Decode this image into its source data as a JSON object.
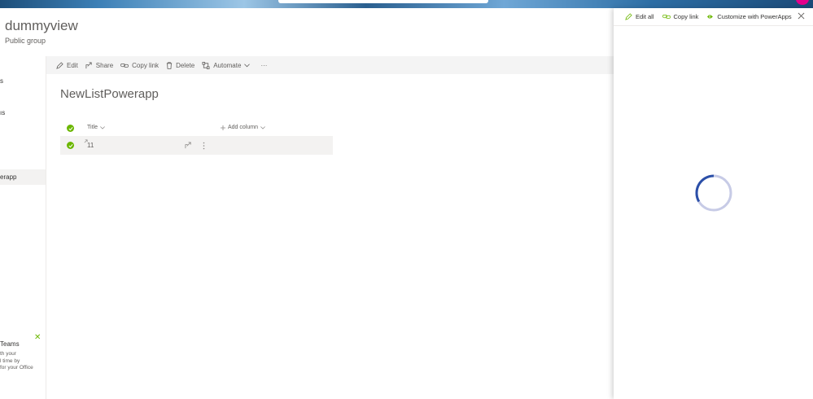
{
  "site": {
    "title": "dummyview",
    "subtitle": "Public group"
  },
  "left_nav": {
    "items": [
      {
        "label": "s"
      },
      {
        "label": "ıs"
      },
      {
        "label": "erapp",
        "selected": true
      }
    ]
  },
  "teams_callout": {
    "title": "Teams",
    "body": "th your\nl time by\nfor your Office"
  },
  "command_bar": {
    "edit": "Edit",
    "share": "Share",
    "copy_link": "Copy link",
    "delete": "Delete",
    "automate": "Automate",
    "more": "···"
  },
  "list": {
    "title": "NewListPowerapp",
    "columns": {
      "title": "Title",
      "add_column": "Add column"
    },
    "rows": [
      {
        "title": "11"
      }
    ]
  },
  "panel": {
    "edit_all": "Edit all",
    "copy_link": "Copy link",
    "customize": "Customize with PowerApps"
  },
  "colors": {
    "accent_green": "#6bb700",
    "spinner_blue": "#2b4fa8",
    "spinner_track": "#c7cbe6"
  },
  "icons": [
    "pencil-icon",
    "share-icon",
    "link-icon",
    "trash-icon",
    "flow-icon",
    "chevron-down-icon",
    "checkmark-icon",
    "plus-icon",
    "powerapps-icon",
    "close-icon",
    "loading-spinner-icon"
  ]
}
